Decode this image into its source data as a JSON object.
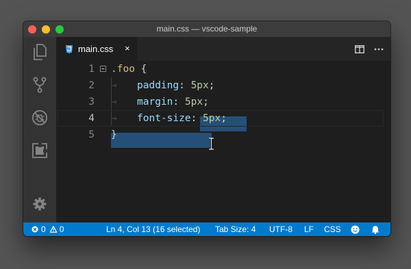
{
  "window": {
    "title": "main.css — vscode-sample"
  },
  "activity_bar": {
    "items": [
      {
        "icon": "explorer-icon"
      },
      {
        "icon": "source-control-icon"
      },
      {
        "icon": "debug-disabled-icon"
      },
      {
        "icon": "extensions-icon"
      },
      {
        "icon": "settings-gear-icon"
      }
    ]
  },
  "tab": {
    "label": "main.css",
    "close_glyph": "×",
    "icon": "css-file-icon"
  },
  "editor_actions": {
    "split": "split-editor-icon",
    "more": "more-actions-icon"
  },
  "editor": {
    "active_line": 4,
    "lines": [
      {
        "number": "1",
        "selector": ".foo",
        "brace": " {"
      },
      {
        "number": "2",
        "property": "padding",
        "colon": ": ",
        "value": "5px",
        "semi": ";"
      },
      {
        "number": "3",
        "property": "margin",
        "colon": ": ",
        "value": "5px",
        "semi": ";"
      },
      {
        "number": "4",
        "property": "font-size",
        "colon": ": ",
        "value": "5px",
        "semi": ";"
      },
      {
        "number": "5",
        "brace": "}"
      }
    ],
    "indent_arrow": "→"
  },
  "status_bar": {
    "errors": "0",
    "warnings": "0",
    "cursor_position": "Ln 4, Col 13 (16 selected)",
    "tab_size": "Tab Size: 4",
    "encoding": "UTF-8",
    "line_ending": "LF",
    "language": "CSS",
    "feedback_icon": "smiley-icon",
    "notifications_icon": "bell-icon"
  },
  "colors": {
    "statusbar": "#007acc",
    "selection": "#264f78",
    "selector": "#d7ba7d",
    "property": "#9cdcfe",
    "number": "#b5cea8"
  }
}
